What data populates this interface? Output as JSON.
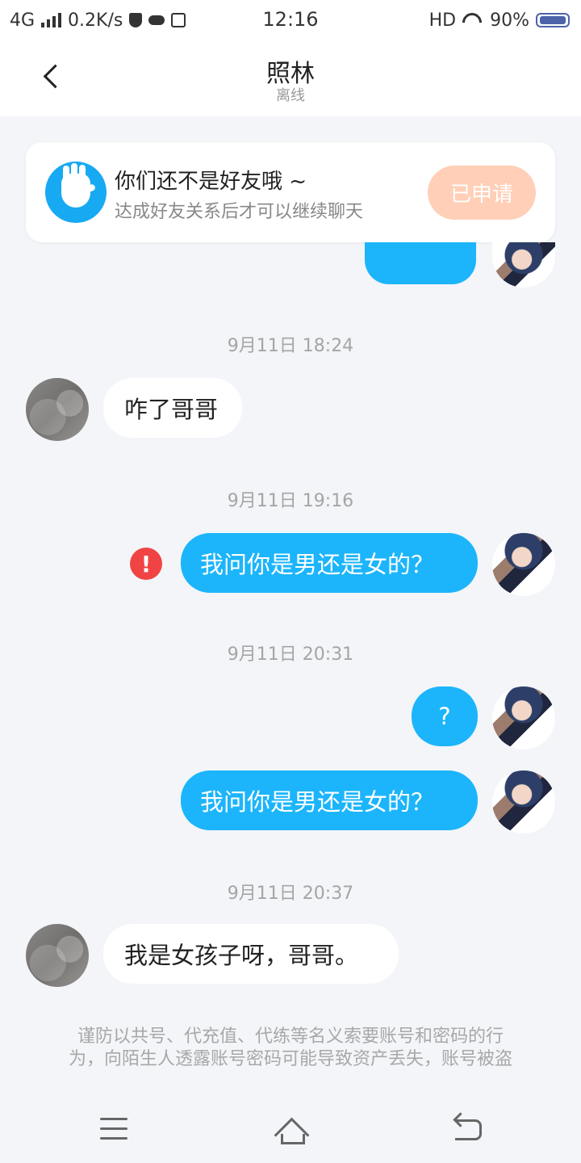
{
  "status_bar": {
    "network": "4G",
    "speed": "0.2K/s",
    "time": "12:16",
    "hd": "HD",
    "battery": "90%"
  },
  "header": {
    "title": "照林",
    "subtitle": "离线"
  },
  "friend_notice": {
    "title": "你们还不是好友哦 ~",
    "description": "达成好友关系后才可以继续聊天",
    "button": "已申请"
  },
  "messages": [
    {
      "type": "timestamp",
      "text": "9月11日 18:24"
    },
    {
      "type": "incoming",
      "text": "咋了哥哥"
    },
    {
      "type": "timestamp",
      "text": "9月11日 19:16"
    },
    {
      "type": "outgoing",
      "text": "我问你是男还是女的？",
      "error": "!"
    },
    {
      "type": "timestamp",
      "text": "9月11日 20:31"
    },
    {
      "type": "outgoing",
      "text": "?"
    },
    {
      "type": "outgoing",
      "text": "我问你是男还是女的？"
    },
    {
      "type": "timestamp",
      "text": "9月11日 20:37"
    },
    {
      "type": "incoming",
      "text": "我是女孩子呀，哥哥。"
    }
  ],
  "warning": {
    "line1": "谨防以共号、代充值、代练等名义索要账号和密码的行",
    "line2": "为，向陌生人透露账号密码可能导致资产丢失，账号被盗"
  },
  "icons": {
    "back": "back-icon",
    "friend": "hand-icon",
    "error": "error-icon",
    "menu": "menu-icon",
    "home": "home-icon",
    "return": "return-icon"
  },
  "colors": {
    "accent": "#1cb5fb",
    "applied": "#ffcfb7",
    "error": "#f04444"
  }
}
